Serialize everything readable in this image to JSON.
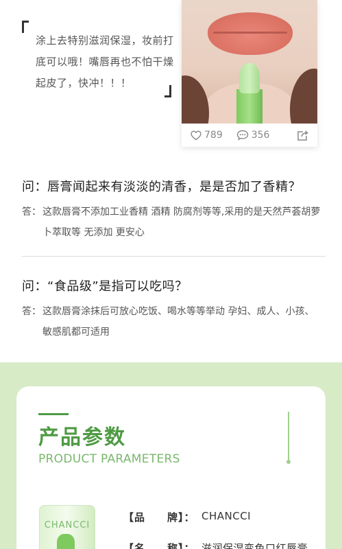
{
  "review": {
    "text": "涂上去特别滋润保湿，妆前打底可以哦！嘴唇再也不怕干燥起皮了，快冲！！！",
    "likes": "789",
    "comments": "356"
  },
  "qa": [
    {
      "question": "问：唇膏闻起来有淡淡的清香，是是否加了香精？",
      "answer_prefix": "答：",
      "answer": "这款唇膏不添加工业香精 酒精 防腐剂等等,采用的是天然芦荟胡萝卜萃取等 无添加 更安心"
    },
    {
      "question": "问：“食品级”是指可以吃吗？",
      "answer_prefix": "答：",
      "answer": "这款唇膏涂抹后可放心吃饭、喝水等等举动 孕妇、成人、小孩、敏感肌都可适用"
    }
  ],
  "parameters": {
    "title_cn": "产品参数",
    "title_en": "PRODUCT PARAMETERS",
    "product_brand_text": "CHANCCI",
    "rows": [
      {
        "label": "【品　　牌】：",
        "value": "CHANCCI"
      },
      {
        "label": "【名　　称】：",
        "value": "滋润保湿变色口红唇膏"
      }
    ]
  },
  "colors": {
    "accent_green": "#4e9a43",
    "light_green_bg": "#d7ebc7",
    "en_title_green": "#7ab86d"
  },
  "icons": [
    "heart-icon",
    "comment-icon",
    "share-icon"
  ]
}
